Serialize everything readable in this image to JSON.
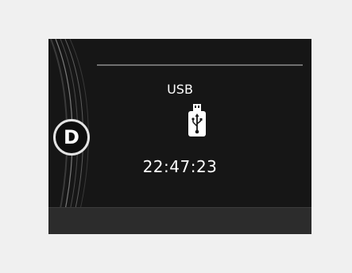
{
  "cluster": {
    "gear": "D",
    "source": "USB",
    "source_icon": "usb-drive-icon",
    "time": "22:47:23"
  },
  "colors": {
    "page_background": "#f0f0f0",
    "screen_background": "#161616",
    "text": "#ffffff",
    "accent_line": "#707070"
  }
}
